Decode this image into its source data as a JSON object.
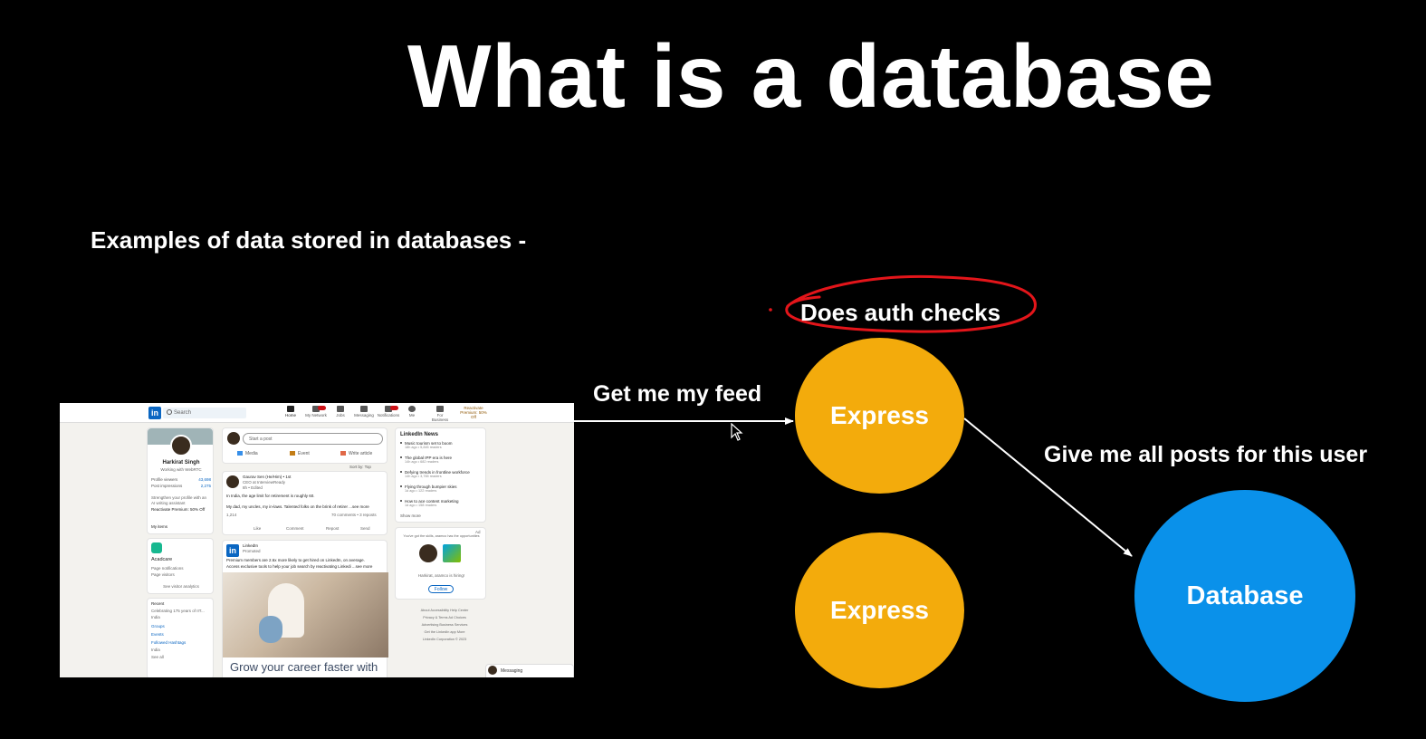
{
  "slide": {
    "title": "What is a database",
    "subtitle": "Examples of data stored in databases -"
  },
  "diagram": {
    "nodes": {
      "express_1": "Express",
      "express_2": "Express",
      "database": "Database"
    },
    "edges": {
      "client_to_express": "Get me my feed",
      "express_to_database": "Give me all posts for this user"
    },
    "annotation": "Does auth checks",
    "colors": {
      "express": "#f3ab0c",
      "database": "#0a91ea",
      "annotation_ink": "#e3151a",
      "background": "#000000"
    }
  },
  "linkedin_screenshot": {
    "logo": "in",
    "search_placeholder": "Search",
    "nav": [
      "Home",
      "My Network",
      "Jobs",
      "Messaging",
      "Notifications",
      "Me",
      "For Business"
    ],
    "premium_cta": "Reactivate Premium: 50% Off",
    "profile": {
      "name": "Harkirat Singh",
      "headline": "Working with WebRTC",
      "viewers_label": "Profile viewers",
      "viewers_value": "43,698",
      "impressions_label": "Post impressions",
      "impressions_value": "2,275",
      "promo": "Strengthen your profile with an AI writing assistant",
      "premium_link": "Reactivate Premium: 50% Off",
      "my_items": "My items"
    },
    "page": {
      "name": "Acadcare",
      "notifications": "Page notifications",
      "visitors": "Page visitors",
      "analytics": "See visitor analytics"
    },
    "recent": {
      "heading": "Recent",
      "item1": "Celebrating 175 years of IIT...",
      "item2": "India",
      "groups": "Groups",
      "events": "Events",
      "hashtags": "Followed Hashtags",
      "hashtag1": "India",
      "see_all": "See all"
    },
    "composer": {
      "placeholder": "Start a post",
      "media": "Media",
      "event": "Event",
      "article": "Write article",
      "sort": "Sort by: Top"
    },
    "post1": {
      "author": "Gaurav Sen (He/Him) • 1st",
      "author_sub": "CEO at InterviewReady",
      "time": "8h • Edited",
      "line1": "In India, the age limit for retirement is roughly 60.",
      "line2": "My dad, my uncles, my in-laws. Talented folks on the brink of retirer ...see more",
      "reactions": "1,214",
      "comments": "70 comments • 3 reposts",
      "like": "Like",
      "comment": "Comment",
      "repost": "Repost",
      "send": "Send"
    },
    "post2": {
      "author": "LinkedIn",
      "author_sub": "Promoted",
      "line1": "Premium members are 2.6x more likely to get hired on LinkedIn, on average.",
      "line2": "Access exclusive tools to help your job search by reactivating Linkedi ...see more",
      "image_caption": "Grow your career faster with"
    },
    "news": {
      "heading": "LinkedIn News",
      "items": [
        {
          "title": "Music tourism set to boom",
          "meta": "18h ago • 5,845 readers"
        },
        {
          "title": "The global IPP era is here",
          "meta": "14h ago • 682 readers"
        },
        {
          "title": "Defying trends in frontline workforce",
          "meta": "14h ago • 3,765 readers"
        },
        {
          "title": "Flying through bumpier skies",
          "meta": "1d ago • 122 readers"
        },
        {
          "title": "How to ace content marketing",
          "meta": "1d ago • 158 readers"
        }
      ],
      "show_more": "Show more"
    },
    "ad": {
      "label": "Ad",
      "text": "You've got the skills, aramco has the opportunities",
      "hiring": "Harkirat, aramco is hiring!",
      "follow": "Follow"
    },
    "footer": {
      "row1": "About   Accessibility   Help Center",
      "row2": "Privacy & Terms   Ad Choices",
      "row3": "Advertising   Business Services",
      "row4": "Get the LinkedIn app   More",
      "copyright": "LinkedIn Corporation © 2023"
    },
    "messaging": "Messaging"
  }
}
